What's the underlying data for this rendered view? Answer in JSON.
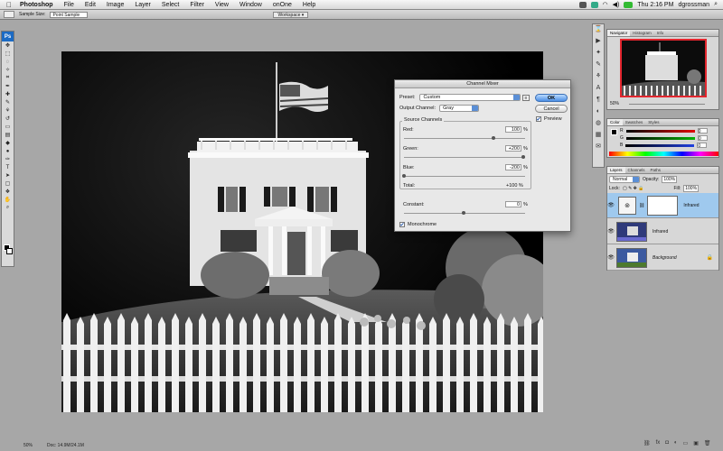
{
  "menubar": {
    "app": "Photoshop",
    "items": [
      "File",
      "Edit",
      "Image",
      "Layer",
      "Select",
      "Filter",
      "View",
      "Window",
      "onOne",
      "Help"
    ],
    "clock": "Thu 2:16 PM",
    "user": "dgrossman"
  },
  "options": {
    "sample_size_label": "Sample Size:",
    "sample_size_value": "Point Sample",
    "workspace": "Workspace ▾"
  },
  "tools": {
    "ps_logo": "Ps"
  },
  "status": {
    "zoom": "50%",
    "doc": "Doc: 14.9M/24.1M"
  },
  "channel_mixer": {
    "title": "Channel Mixer",
    "preset_label": "Preset:",
    "preset_value": "Custom",
    "output_label": "Output Channel:",
    "output_value": "Gray",
    "ok": "OK",
    "cancel": "Cancel",
    "preview": "Preview",
    "source_channels": "Source Channels",
    "red_label": "Red:",
    "red_value": "100",
    "red_fraction": 0.75,
    "green_label": "Green:",
    "green_value": "+200",
    "green_fraction": 1.0,
    "blue_label": "Blue:",
    "blue_value": "-200",
    "blue_fraction": 0.0,
    "total_label": "Total:",
    "total_value": "+100 %",
    "constant_label": "Constant:",
    "constant_value": "0",
    "constant_fraction": 0.5,
    "monochrome": "Monochrome",
    "pct": "%"
  },
  "panels": {
    "navigator_tabs": [
      "Navigator",
      "Histogram",
      "Info"
    ],
    "nav_zoom": "50%",
    "color_tabs": [
      "Color",
      "Swatches",
      "Styles"
    ],
    "color_rows": [
      {
        "label": "R",
        "gradient": "#e00000"
      },
      {
        "label": "G",
        "gradient": "#00b000"
      },
      {
        "label": "B",
        "gradient": "#2040e0"
      }
    ],
    "color_values": [
      "0",
      "0",
      "0"
    ],
    "layers_tabs": [
      "Layers",
      "Channels",
      "Paths"
    ],
    "blend_mode": "Normal",
    "opacity_label": "Opacity:",
    "opacity_value": "100%",
    "lock_label": "Lock:",
    "fill_label": "Fill:",
    "fill_value": "100%",
    "layers": [
      {
        "name": "Infrared",
        "italic": false,
        "selected": true
      },
      {
        "name": "Infrared",
        "italic": false,
        "selected": false
      },
      {
        "name": "Background",
        "italic": true,
        "selected": false
      }
    ]
  },
  "colors": {
    "accent_blue": "#1c6bc4",
    "navigator_frame": "#e2262e",
    "selection": "#9fc9ee"
  }
}
